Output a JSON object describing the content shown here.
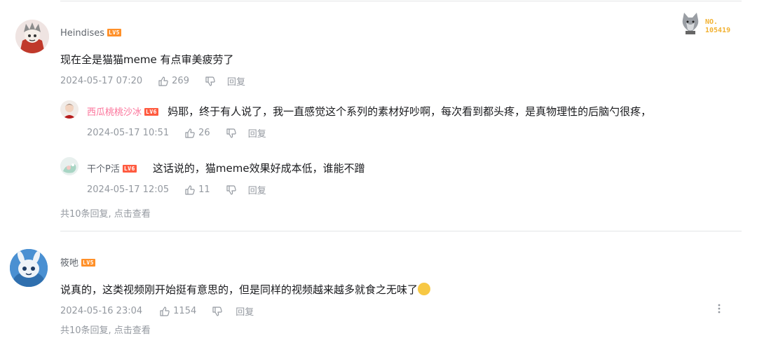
{
  "colors": {
    "accent_pink": "#fb7299",
    "meta_gray": "#9499a0",
    "level_orange": "#ff9029",
    "level_red": "#ff5b40"
  },
  "comments": [
    {
      "username": "Heindises",
      "level": "LV5",
      "fan_badge_label": "NO.",
      "fan_badge_number": "105419",
      "content": "现在全是猫猫meme 有点审美疲劳了",
      "time": "2024-05-17 07:20",
      "likes": "269",
      "reply_label": "回复",
      "replies": [
        {
          "username": "西瓜桃桃沙冰",
          "level": "LV6",
          "content": "妈耶，终于有人说了，我一直感觉这个系列的素材好吵啊，每次看到都头疼，是真物理性的后脑勺很疼，",
          "time": "2024-05-17 10:51",
          "likes": "26",
          "reply_label": "回复"
        },
        {
          "username": "干个P活",
          "level": "LV6",
          "content": "这话说的，猫meme效果好成本低，谁能不蹭",
          "time": "2024-05-17 12:05",
          "likes": "11",
          "reply_label": "回复"
        }
      ],
      "view_more": "共10条回复, 点击查看"
    },
    {
      "username": "筱吔",
      "level": "LV5",
      "content": "说真的，这类视频刚开始挺有意思的，但是同样的视频越来越多就食之无味了",
      "emoji": "😣",
      "time": "2024-05-16 23:04",
      "likes": "1154",
      "reply_label": "回复",
      "view_more": "共10条回复, 点击查看"
    }
  ]
}
